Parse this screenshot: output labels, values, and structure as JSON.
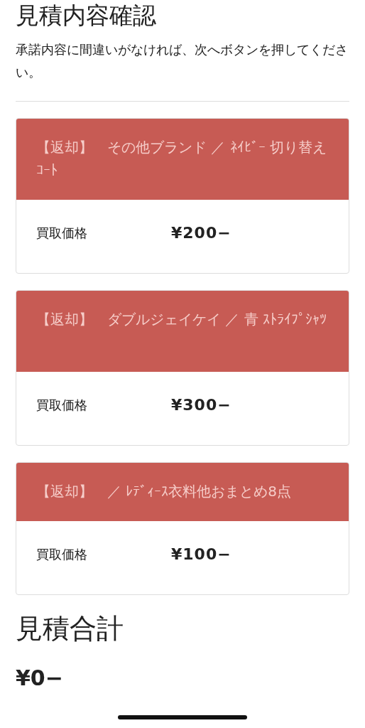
{
  "title": "見積内容確認",
  "description": "承諾内容に間違いがなければ、次へボタンを押してください。",
  "items": [
    {
      "header": "【返却】　その他ブランド ／ ﾈｲﾋﾞｰ 切り替えｺｰﾄ",
      "price_label": "買取価格",
      "price": "¥200−"
    },
    {
      "header": "【返却】　ダブルジェイケイ ／ 青 ｽﾄﾗｲﾌﾟｼｬﾂ",
      "price_label": "買取価格",
      "price": "¥300−"
    },
    {
      "header": "【返却】　／ ﾚﾃﾞｨｰｽ衣料他おまとめ8点",
      "price_label": "買取価格",
      "price": "¥100−"
    }
  ],
  "total": {
    "heading": "見積合計",
    "amount": "¥0−"
  }
}
